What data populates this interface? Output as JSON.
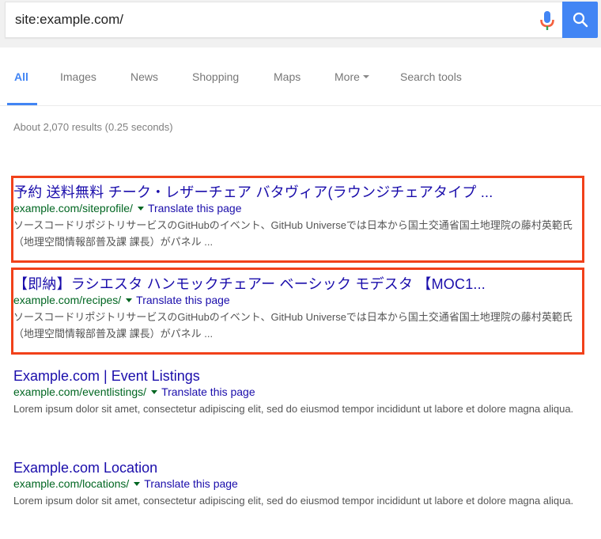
{
  "search": {
    "query": "site:example.com/",
    "mic_icon": "microphone-icon",
    "search_icon": "magnifier-icon",
    "button_color": "#4285f4"
  },
  "tabs": [
    {
      "label": "All",
      "active": true
    },
    {
      "label": "Images"
    },
    {
      "label": "News"
    },
    {
      "label": "Shopping"
    },
    {
      "label": "Maps"
    },
    {
      "label": "More",
      "has_dropdown": true
    },
    {
      "label": "Search tools"
    }
  ],
  "stats": "About 2,070 results (0.25 seconds)",
  "colors": {
    "title": "#1a0dab",
    "url": "#006621",
    "snippet": "#545454",
    "highlight_border": "#f1411a",
    "accent": "#4285f4"
  },
  "results": [
    {
      "title": "予約 送料無料 チーク・レザーチェア バタヴィア(ラウンジチェアタイプ ...",
      "url": "example.com/siteprofile/",
      "translate": "Translate this page",
      "snippet": "ソースコードリポジトリサービスのGitHubのイベント、GitHub Universeでは日本から国土交通省国土地理院の藤村英範氏（地理空間情報部普及課 課長）がパネル ...",
      "highlighted": true
    },
    {
      "title": "【即納】ラシエスタ ハンモックチェアー ベーシック モデスタ 【MOC1...",
      "url": "example.com/recipes/",
      "translate": "Translate this page",
      "snippet": "ソースコードリポジトリサービスのGitHubのイベント、GitHub Universeでは日本から国土交通省国土地理院の藤村英範氏（地理空間情報部普及課 課長）がパネル ...",
      "highlighted": true
    },
    {
      "title": "Example.com | Event Listings",
      "url": "example.com/eventlistings/",
      "translate": "Translate this page",
      "snippet": "Lorem ipsum dolor sit amet, consectetur adipiscing elit, sed do eiusmod tempor incididunt ut labore et dolore magna aliqua.",
      "highlighted": false
    },
    {
      "title": "Example.com Location",
      "url": "example.com/locations/",
      "translate": "Translate this page",
      "snippet": "Lorem ipsum dolor sit amet, consectetur adipiscing elit, sed do eiusmod tempor incididunt ut labore et dolore magna aliqua.",
      "highlighted": false
    }
  ]
}
